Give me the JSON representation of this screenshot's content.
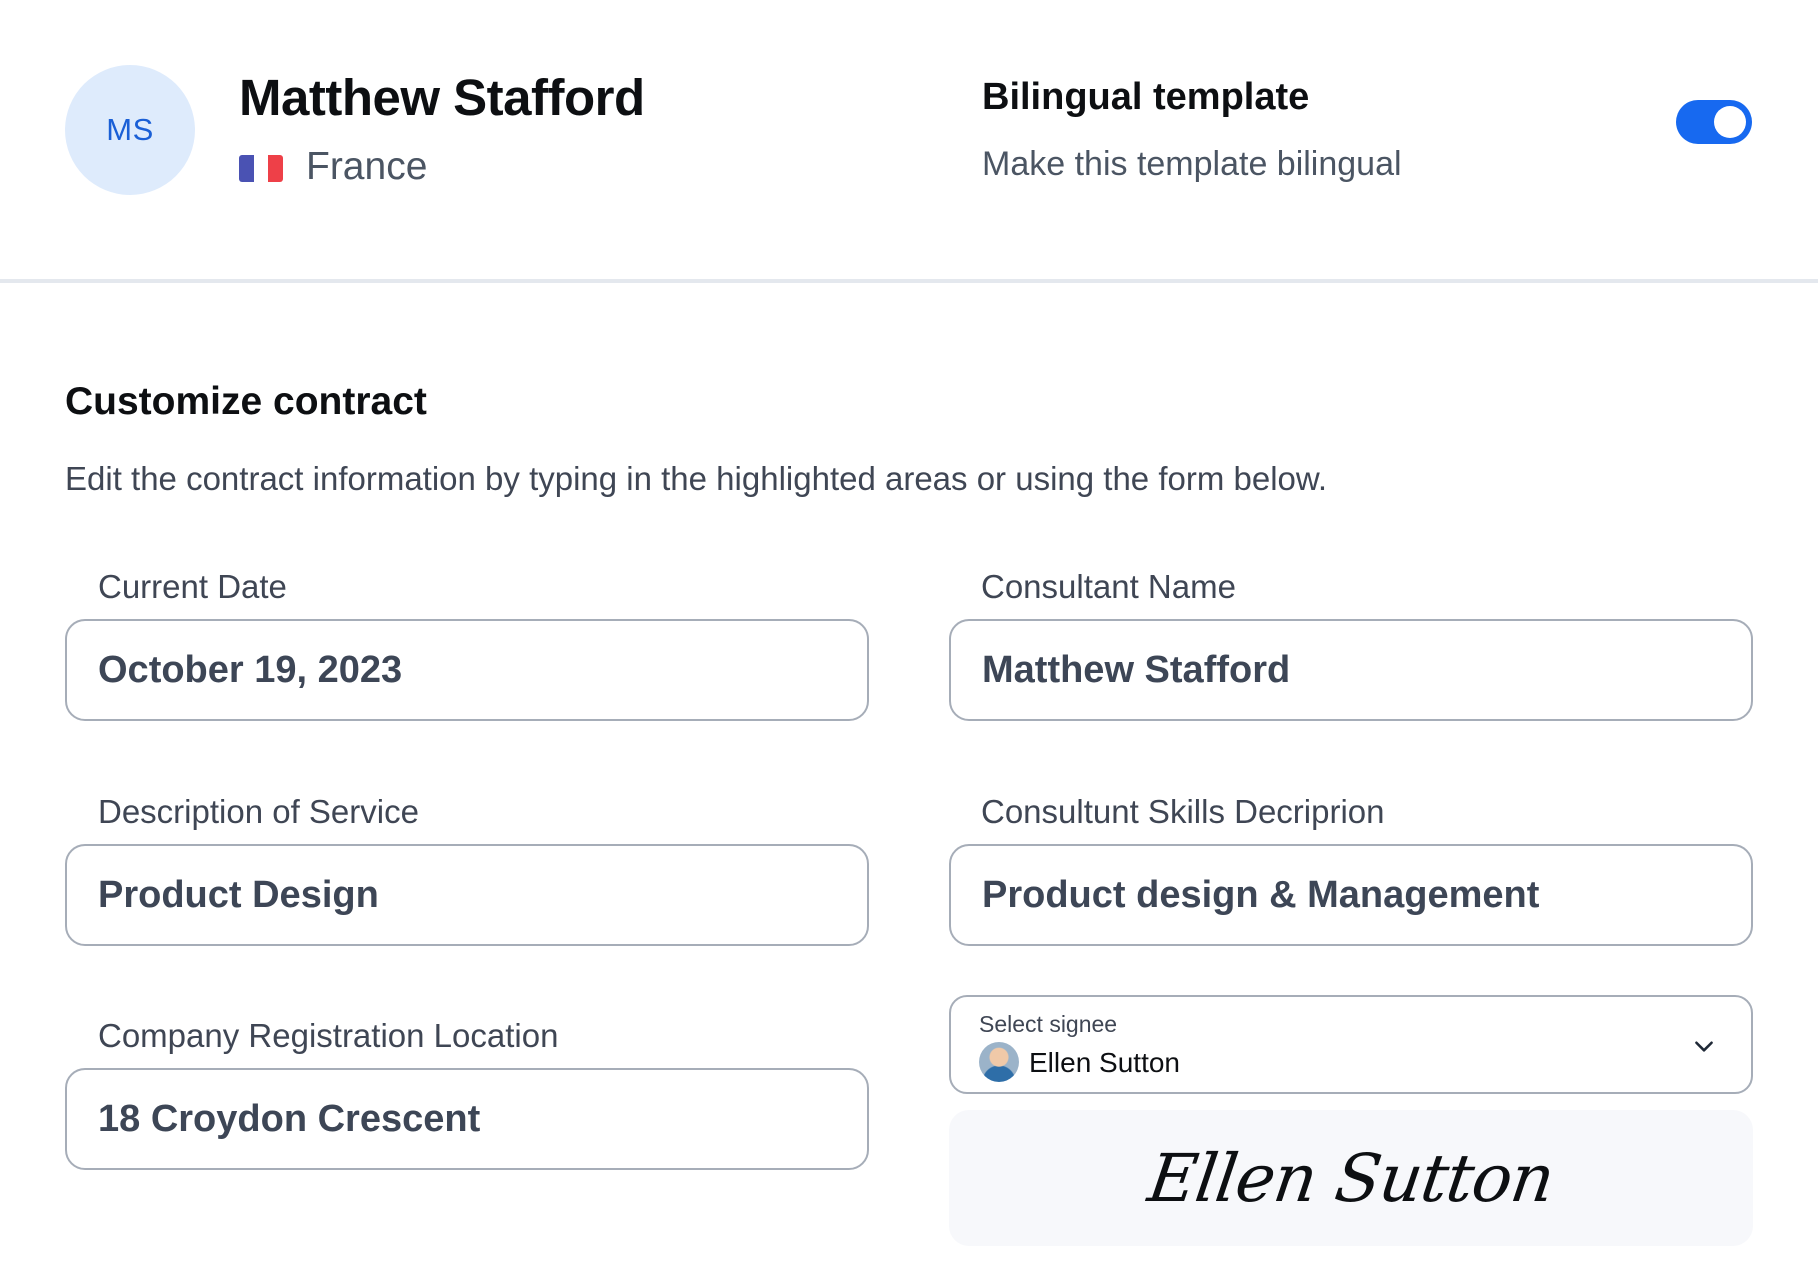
{
  "header": {
    "avatar_initials": "MS",
    "name": "Matthew Stafford",
    "country": "France",
    "flag_icon": "france-flag-icon",
    "bilingual": {
      "title": "Bilingual template",
      "description": "Make this template bilingual",
      "enabled": true
    }
  },
  "section": {
    "title": "Customize contract",
    "description": "Edit the contract information by typing in the highlighted areas or using the form below."
  },
  "fields": {
    "current_date": {
      "label": "Current Date",
      "value": "October 19, 2023"
    },
    "consultant_name": {
      "label": "Consultant Name",
      "value": "Matthew Stafford"
    },
    "service_description": {
      "label": "Description of Service",
      "value": "Product Design"
    },
    "skills_description": {
      "label": "Consultunt Skills Decriprion",
      "value": "Product design & Management"
    },
    "registration_location": {
      "label": "Company Registration Location",
      "value": "18 Croydon Crescent"
    }
  },
  "signee": {
    "label": "Select signee",
    "value": "Ellen Sutton",
    "signature": "Ellen Sutton"
  },
  "colors": {
    "accent": "#1769f0",
    "avatar_bg": "#deebfc",
    "avatar_text": "#1a5fd6"
  }
}
